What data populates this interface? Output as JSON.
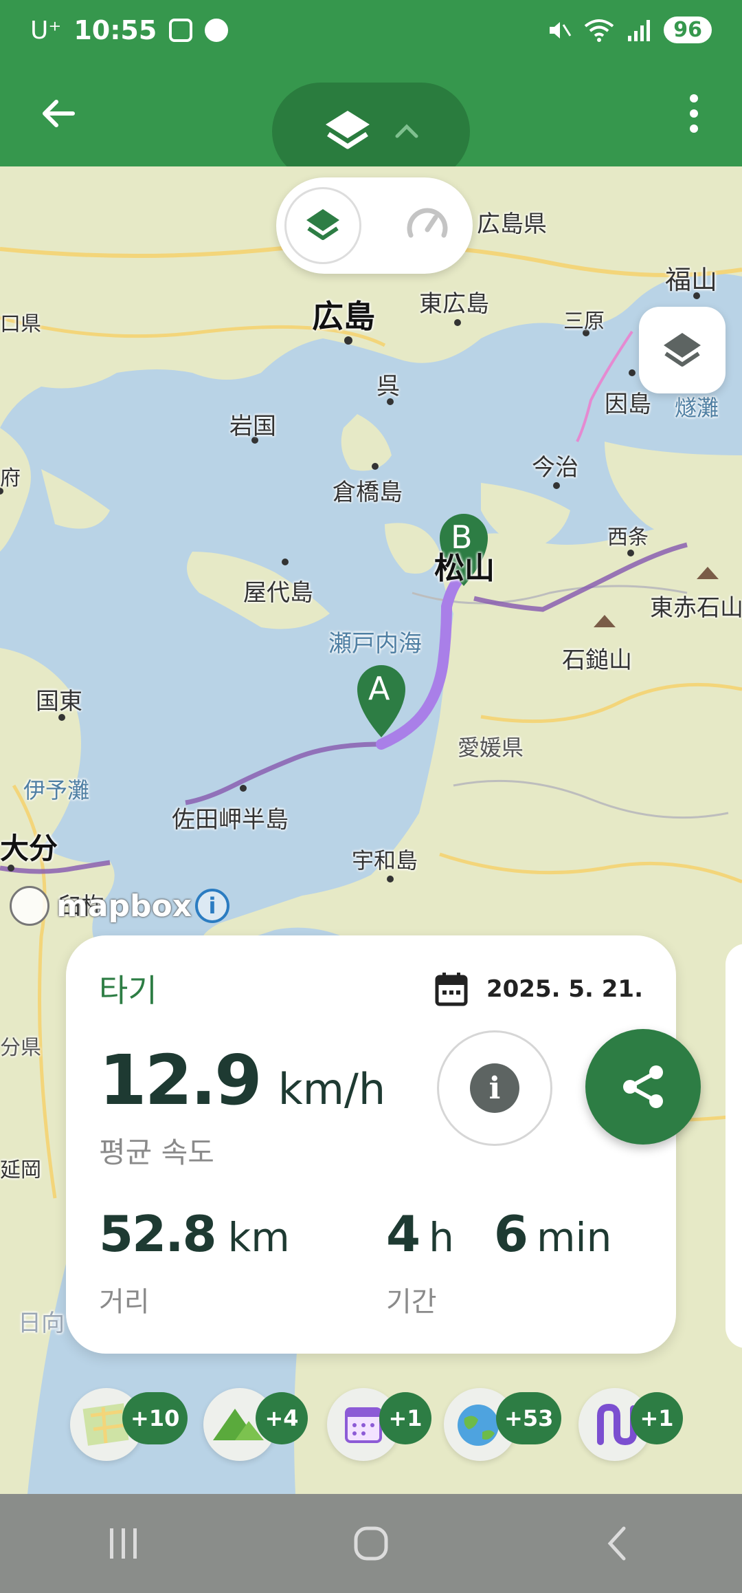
{
  "status_bar": {
    "carrier": "U⁺",
    "time": "10:55",
    "battery": "96",
    "colors": {
      "bg": "#36974d"
    }
  },
  "app_bar": {
    "back_icon": "arrow-left-icon",
    "layers_icon": "layers-icon",
    "chevron_icon": "chevron-up-icon",
    "more_icon": "more-vert-icon"
  },
  "map": {
    "labels": {
      "hiroshima": "広島",
      "higashihiroshima": "東広島",
      "hiroshima_pref": "広島県",
      "fukuyama": "福山",
      "mihara": "三原",
      "kure": "呉",
      "iwakuni": "岩国",
      "innoshima": "因島",
      "hiuchinada": "燧灘",
      "imabari": "今治",
      "kurahashijima": "倉橋島",
      "saijo": "西条",
      "yashirojima": "屋代島",
      "matsuyama": "松山",
      "higashiakaishi": "東赤石山",
      "setonaikai": "瀬戸内海",
      "ishizuchi": "石鎚山",
      "kunisaki": "国東",
      "ehime": "愛媛県",
      "iyonada": "伊予灘",
      "sadamisaki": "佐田岬半島",
      "oita": "大分",
      "uwajima": "宇和島",
      "usuki": "臼杵",
      "fu": "府",
      "ken_left": "口県",
      "ken_oita": "分県",
      "nobeoka": "延岡",
      "hyuga": "日向"
    },
    "markers": {
      "start": "A",
      "end": "B"
    },
    "attribution": "mapbox",
    "info": "i"
  },
  "summary_card": {
    "activity_type": "타기",
    "date": "2025. 5. 21.",
    "avg_speed": "12.9",
    "avg_speed_unit": "km/h",
    "avg_speed_label": "평균 속도",
    "distance": "52.8",
    "distance_unit": "km",
    "distance_label": "거리",
    "duration_hours": "4",
    "duration_hours_unit": "h",
    "duration_minutes": "6",
    "duration_minutes_unit": "min",
    "duration_label": "기간"
  },
  "badges": [
    {
      "icon": "map-badge-icon",
      "count": "+10"
    },
    {
      "icon": "mountain-badge-icon",
      "count": "+4"
    },
    {
      "icon": "calendar-badge-icon",
      "count": "+1"
    },
    {
      "icon": "globe-badge-icon",
      "count": "+53"
    },
    {
      "icon": "route-badge-icon",
      "count": "+1"
    }
  ],
  "colors": {
    "accent": "#2d7d44",
    "route": "#a97fe8",
    "route_other": "#8a5fb0",
    "water": "#b9d3e6",
    "land": "#e6e9c6"
  }
}
